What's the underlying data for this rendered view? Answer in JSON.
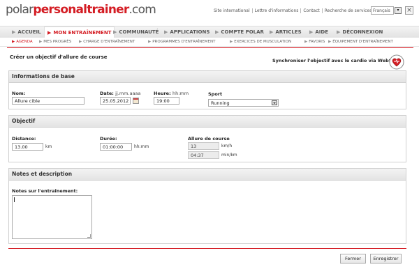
{
  "header": {
    "logo_part1": "polar",
    "logo_part2": "personaltrainer",
    "logo_part3": ".com",
    "links": [
      "Site international",
      "Lettre d'informations",
      "Contact",
      "Recherche de services"
    ],
    "language": "Français",
    "close_glyph": "×"
  },
  "main_nav": [
    "ACCUEIL",
    "MON ENTRAÎNEMENT",
    "COMMUNAUTÉ",
    "APPLICATIONS",
    "COMPTE POLAR",
    "ARTICLES",
    "AIDE",
    "DÉCONNEXION"
  ],
  "main_nav_active_index": 1,
  "sub_nav": [
    "AGENDA",
    "MES PROGRÈS",
    "CHARGE D'ENTRAÎNEMENT",
    "PROGRAMMES D'ENTRAÎNEMENT",
    "EXERCICES DE MUSCULATION",
    "FAVORIS",
    "ÉQUIPEMENT D'ENTRAÎNEMENT"
  ],
  "sub_nav_active_index": 0,
  "arrow_glyph": "▶",
  "page": {
    "title": "Créer un objectif d'allure de course",
    "sync_text": "Synchroniser l'objectif avec le cardio via WebSync"
  },
  "basic_info": {
    "header": "Informations de base",
    "name_label": "Nom:",
    "name_value": "Allure cible",
    "date_label": "Date:",
    "date_hint": "jj.mm.aaaa",
    "date_value": "25.05.2012",
    "time_label": "Heure:",
    "time_hint": "hh:mm",
    "time_value": "19:00",
    "sport_label": "Sport",
    "sport_value": "Running"
  },
  "objective": {
    "header": "Objectif",
    "distance_label": "Distance:",
    "distance_value": "13.00",
    "distance_unit": "km",
    "duration_label": "Durée:",
    "duration_value": "01:00:00",
    "duration_unit": "hh:mm",
    "pace_label": "Allure de course",
    "speed_value": "13",
    "speed_unit": "km/h",
    "pace_value": "04:37",
    "pace_unit": "min/km"
  },
  "notes": {
    "header": "Notes et description",
    "notes_label": "Notes sur l'entraînement:",
    "notes_value": ""
  },
  "buttons": {
    "close": "Fermer",
    "save": "Enregistrer"
  },
  "colors": {
    "accent": "#d41d24",
    "panel_header": "#e8e8e8"
  }
}
